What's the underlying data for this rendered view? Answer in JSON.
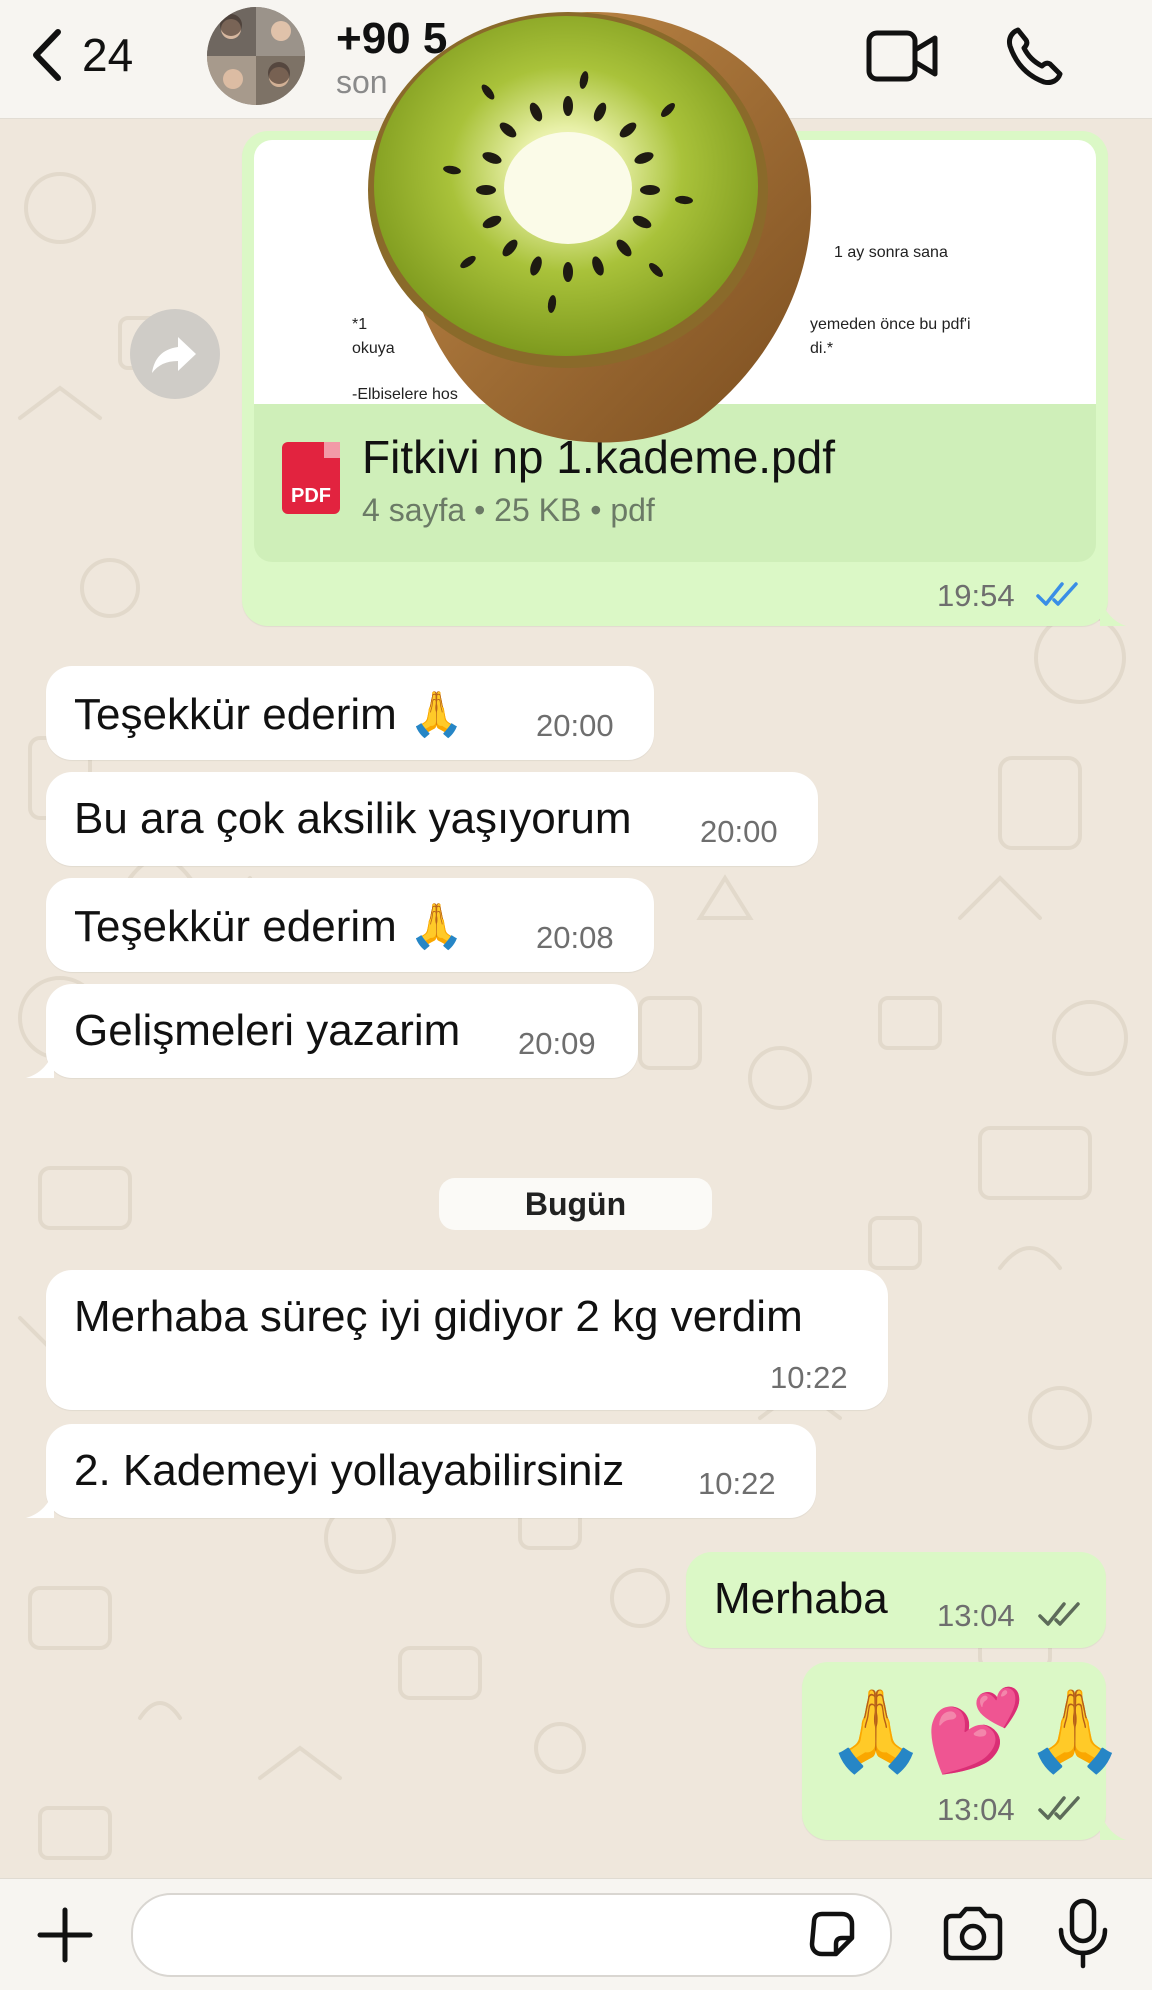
{
  "header": {
    "back_count": "24",
    "contact_name": "+90 5",
    "contact_sub": "son"
  },
  "pdf_message": {
    "preview_lines": [
      "1 ay sonra sana",
      "*1",
      "yemeden önce bu pdf'i",
      "okuya",
      "di.*",
      "-Elbiselere hos"
    ],
    "file_name": "Fitkivi np 1.kademe.pdf",
    "meta": "4 sayfa • 25 KB • pdf",
    "badge": "PDF",
    "time": "19:54"
  },
  "messages": [
    {
      "text": "Teşekkür ederim 🙏",
      "time": "20:00"
    },
    {
      "text": "Bu ara çok aksilik yaşıyorum",
      "time": "20:00"
    },
    {
      "text": "Teşekkür ederim 🙏",
      "time": "20:08"
    },
    {
      "text": "Gelişmeleri yazarim",
      "time": "20:09"
    },
    {
      "text": "Merhaba süreç iyi gidiyor 2 kg verdim",
      "time": "10:22"
    },
    {
      "text": "2. Kademeyi yollayabilirsiniz",
      "time": "10:22"
    },
    {
      "text": "Merhaba",
      "time": "13:04"
    },
    {
      "text": "🙏💕🙏",
      "time": "13:04"
    }
  ],
  "date_divider": "Bugün",
  "colors": {
    "outgoing_bubble": "#dbf8c6",
    "incoming_bubble": "#ffffff",
    "read_ticks": "#3a8ee6"
  },
  "icons": [
    "chevron-left-icon",
    "video-call-icon",
    "phone-icon",
    "forward-icon",
    "double-check-icon",
    "plus-icon",
    "sticker-icon",
    "camera-icon",
    "microphone-icon",
    "kiwi-sticker"
  ]
}
